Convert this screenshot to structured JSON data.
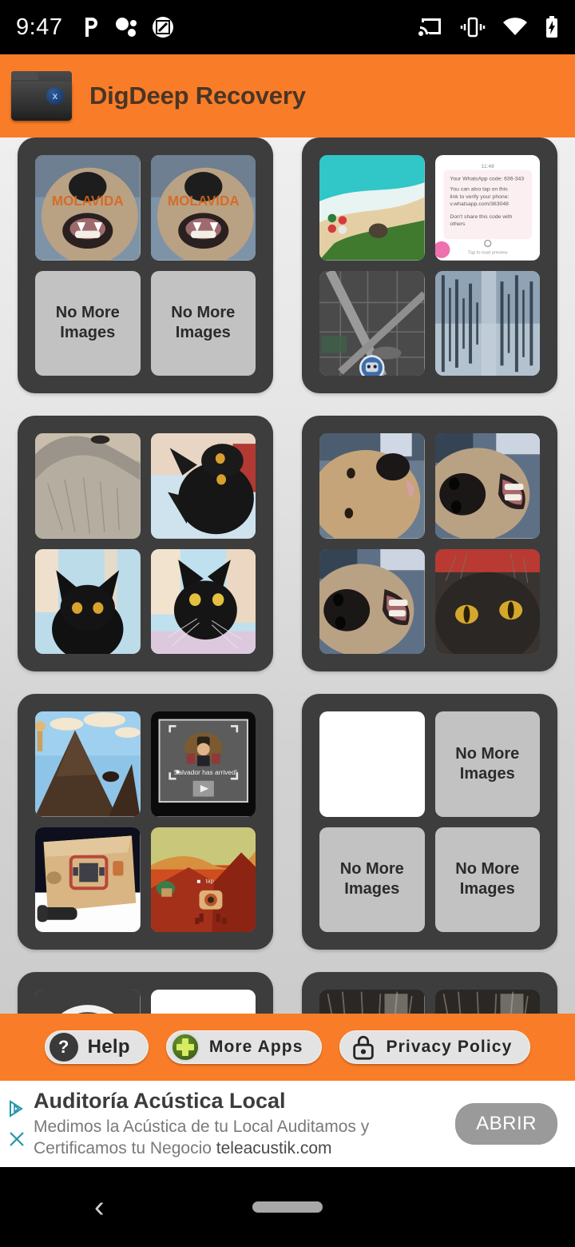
{
  "statusbar": {
    "time": "9:47",
    "left_icons": [
      "pinterest-icon",
      "bubbles-icon",
      "screenshot-icon"
    ],
    "right_icons": [
      "cast-icon",
      "vibrate-icon",
      "wifi-icon",
      "battery-charging-icon"
    ]
  },
  "appbar": {
    "title": "DigDeep Recovery",
    "icon": "folder-recovery-icon",
    "badge": "x",
    "background": "#f97d28"
  },
  "placeholder_label": "No More\nImages",
  "placeholder_line1": "No More",
  "placeholder_line2": "Images",
  "cards": [
    {
      "name": "card-dog-molavida",
      "thumbs": [
        {
          "name": "thumb-dog-molavida-1",
          "kind": "image",
          "art": "dog-watermark"
        },
        {
          "name": "thumb-dog-molavida-2",
          "kind": "image",
          "art": "dog-watermark"
        },
        {
          "name": "thumb-no-more-images-1",
          "kind": "nomore"
        },
        {
          "name": "thumb-no-more-images-2",
          "kind": "nomore"
        }
      ]
    },
    {
      "name": "card-screenshots",
      "thumbs": [
        {
          "name": "thumb-beach-wallpaper",
          "kind": "image",
          "art": "beach"
        },
        {
          "name": "thumb-whatsapp-sms",
          "kind": "image",
          "art": "sms"
        },
        {
          "name": "thumb-map",
          "kind": "image",
          "art": "map"
        },
        {
          "name": "thumb-audio-waveform",
          "kind": "image",
          "art": "waveform"
        }
      ]
    },
    {
      "name": "card-cats",
      "thumbs": [
        {
          "name": "thumb-grey-fur",
          "kind": "image",
          "art": "fur"
        },
        {
          "name": "thumb-black-cat-1",
          "kind": "image",
          "art": "cat-a"
        },
        {
          "name": "thumb-black-cat-2",
          "kind": "image",
          "art": "cat-b"
        },
        {
          "name": "thumb-black-cat-3",
          "kind": "image",
          "art": "cat-c"
        }
      ]
    },
    {
      "name": "card-dogs-closeup",
      "thumbs": [
        {
          "name": "thumb-dog-closeup-1",
          "kind": "image",
          "art": "dog2"
        },
        {
          "name": "thumb-dog-closeup-2",
          "kind": "image",
          "art": "dog3"
        },
        {
          "name": "thumb-dog-closeup-3",
          "kind": "image",
          "art": "dog3"
        },
        {
          "name": "thumb-cat-eyes",
          "kind": "image",
          "art": "cat-eyes"
        }
      ]
    },
    {
      "name": "card-game-screens",
      "thumbs": [
        {
          "name": "thumb-game-mountain",
          "kind": "image",
          "art": "game-mountain"
        },
        {
          "name": "thumb-game-salvador",
          "kind": "image",
          "art": "game-salvador",
          "caption": "Salvador has arrived!"
        },
        {
          "name": "thumb-game-box",
          "kind": "image",
          "art": "game-box"
        },
        {
          "name": "thumb-game-red-hill",
          "kind": "image",
          "art": "game-red",
          "caption": "tap"
        }
      ]
    },
    {
      "name": "card-empty",
      "thumbs": [
        {
          "name": "thumb-blank-white",
          "kind": "blank"
        },
        {
          "name": "thumb-no-more-images-3",
          "kind": "nomore"
        },
        {
          "name": "thumb-no-more-images-4",
          "kind": "nomore"
        },
        {
          "name": "thumb-no-more-images-5",
          "kind": "nomore"
        }
      ]
    },
    {
      "name": "card-logos-partial",
      "thumbs": [
        {
          "name": "thumb-smiley-logo",
          "kind": "image",
          "art": "smiley"
        },
        {
          "name": "thumb-white-shape",
          "kind": "image",
          "art": "shape"
        },
        {
          "name": "thumb-hidden-1",
          "kind": "image",
          "art": "fur"
        },
        {
          "name": "thumb-hidden-2",
          "kind": "image",
          "art": "fur"
        }
      ]
    },
    {
      "name": "card-cat-faces-partial",
      "thumbs": [
        {
          "name": "thumb-cat-face-1",
          "kind": "image",
          "art": "cat-face"
        },
        {
          "name": "thumb-cat-face-2",
          "kind": "image",
          "art": "cat-face"
        },
        {
          "name": "thumb-hidden-3",
          "kind": "image",
          "art": "cat-face"
        },
        {
          "name": "thumb-hidden-4",
          "kind": "image",
          "art": "cat-face"
        }
      ]
    }
  ],
  "actionbar": {
    "help_label": "Help",
    "help_icon": "question-mark-icon",
    "more_apps_label": "More Apps",
    "more_apps_icon": "plus-badge-icon",
    "privacy_label": "Privacy Policy",
    "privacy_icon": "lock-icon"
  },
  "ad": {
    "title": "Auditoría Acústica Local",
    "description": "Medimos la Acústica de tu Local Auditamos y Certificamos tu Negocio ",
    "domain": "teleacustik.com",
    "cta": "ABRIR",
    "marker_ad": "ad-choices-icon",
    "marker_close": "close-icon"
  },
  "navbar": {
    "back": "back-icon",
    "home": "home-pill-icon"
  }
}
